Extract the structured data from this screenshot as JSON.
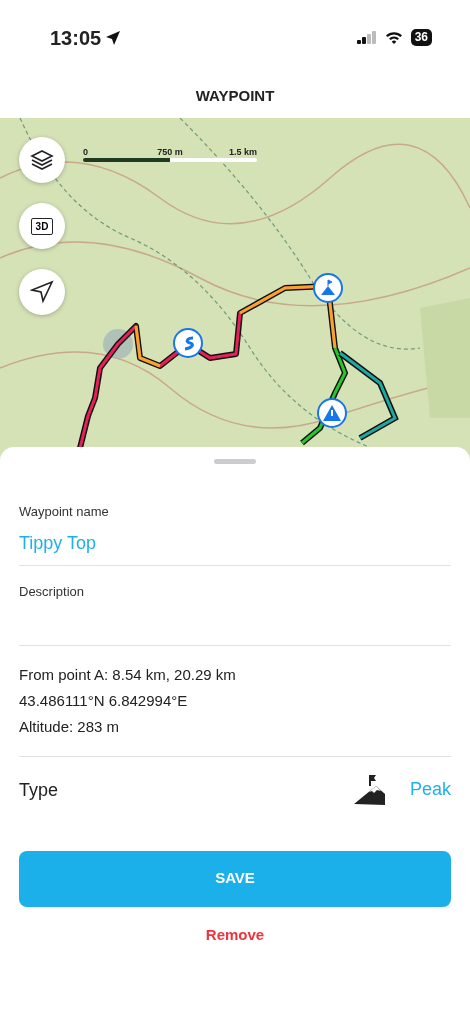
{
  "status_bar": {
    "time": "13:05",
    "battery": "36"
  },
  "header": {
    "title": "WAYPOINT"
  },
  "map": {
    "kind": "picture",
    "scale": [
      "0",
      "750 m",
      "1.5 km"
    ],
    "buttons": [
      {
        "kind": "layers"
      },
      {
        "kind": "threed",
        "label": "3D"
      },
      {
        "kind": "locate"
      }
    ]
  },
  "form": {
    "name_label": "Waypoint name",
    "name_value": "Tippy Top",
    "description_label": "Description",
    "details": [
      "From point A: 8.54 km, 20.29 km",
      "43.486111°N 6.842994°E",
      "Altitude: 283 m"
    ],
    "type_label": "Type",
    "type_value": "Peak"
  },
  "buttons": {
    "save": "SAVE",
    "remove": "Remove"
  }
}
